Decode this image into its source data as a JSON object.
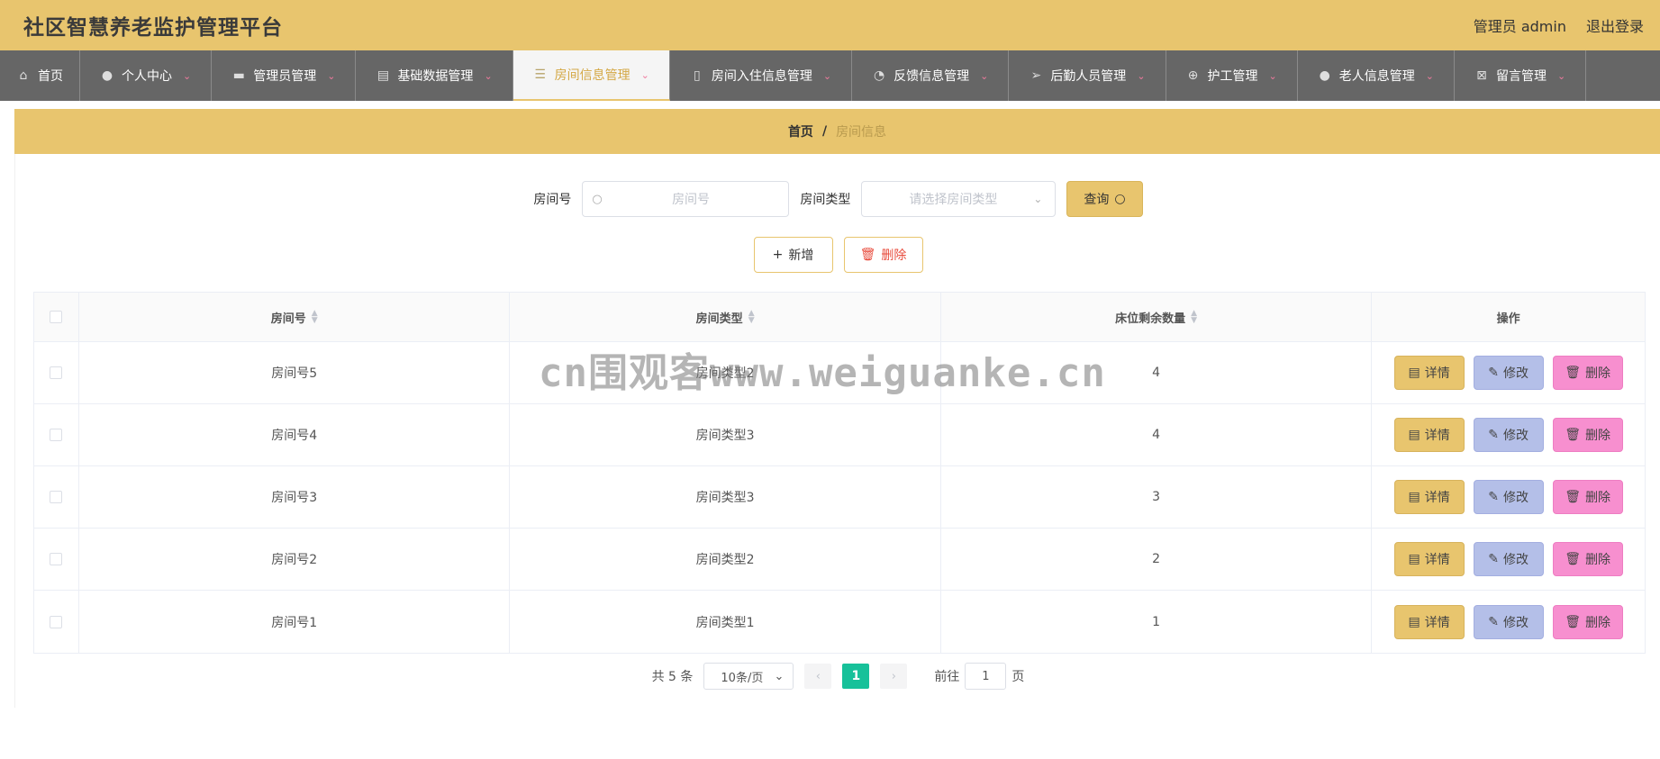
{
  "header": {
    "title": "社区智慧养老监护管理平台",
    "user_label": "管理员 admin",
    "logout": "退出登录"
  },
  "nav": {
    "items": [
      {
        "label": "首页",
        "icon": "home-icon"
      },
      {
        "label": "个人中心",
        "icon": "user-icon"
      },
      {
        "label": "管理员管理",
        "icon": "briefcase-icon"
      },
      {
        "label": "基础数据管理",
        "icon": "clipboard-icon"
      },
      {
        "label": "房间信息管理",
        "icon": "list-icon",
        "active": true
      },
      {
        "label": "房间入住信息管理",
        "icon": "phone-icon"
      },
      {
        "label": "反馈信息管理",
        "icon": "compass-icon"
      },
      {
        "label": "后勤人员管理",
        "icon": "location-arrow-icon"
      },
      {
        "label": "护工管理",
        "icon": "crosshair-icon"
      },
      {
        "label": "老人信息管理",
        "icon": "pin-icon"
      },
      {
        "label": "留言管理",
        "icon": "clipboard-x-icon"
      }
    ]
  },
  "breadcrumb": {
    "home": "首页",
    "separator": "/",
    "current": "房间信息"
  },
  "search": {
    "room_no_label": "房间号",
    "room_no_placeholder": "房间号",
    "room_type_label": "房间类型",
    "room_type_placeholder": "请选择房间类型",
    "query_button": "查询"
  },
  "actions": {
    "add": "新增",
    "delete": "删除"
  },
  "table": {
    "columns": [
      "房间号",
      "房间类型",
      "床位剩余数量",
      "操作"
    ],
    "rows": [
      {
        "room_no": "房间号5",
        "room_type": "房间类型2",
        "beds_left": "4"
      },
      {
        "room_no": "房间号4",
        "room_type": "房间类型3",
        "beds_left": "4"
      },
      {
        "room_no": "房间号3",
        "room_type": "房间类型3",
        "beds_left": "3"
      },
      {
        "room_no": "房间号2",
        "room_type": "房间类型2",
        "beds_left": "2"
      },
      {
        "room_no": "房间号1",
        "room_type": "房间类型1",
        "beds_left": "1"
      }
    ],
    "op_detail": "详情",
    "op_edit": "修改",
    "op_delete": "删除"
  },
  "pagination": {
    "total": "共 5 条",
    "page_size": "10条/页",
    "current_page": "1",
    "goto_label": "前往",
    "goto_value": "1",
    "page_unit": "页"
  },
  "watermark": "cn围观客www.weiguanke.cn",
  "colors": {
    "accent": "#e8c56e",
    "nav_bg": "#666666",
    "page_active": "#17c19a",
    "edit_btn": "#b4bfe8",
    "delete_btn": "#f78fcf"
  }
}
